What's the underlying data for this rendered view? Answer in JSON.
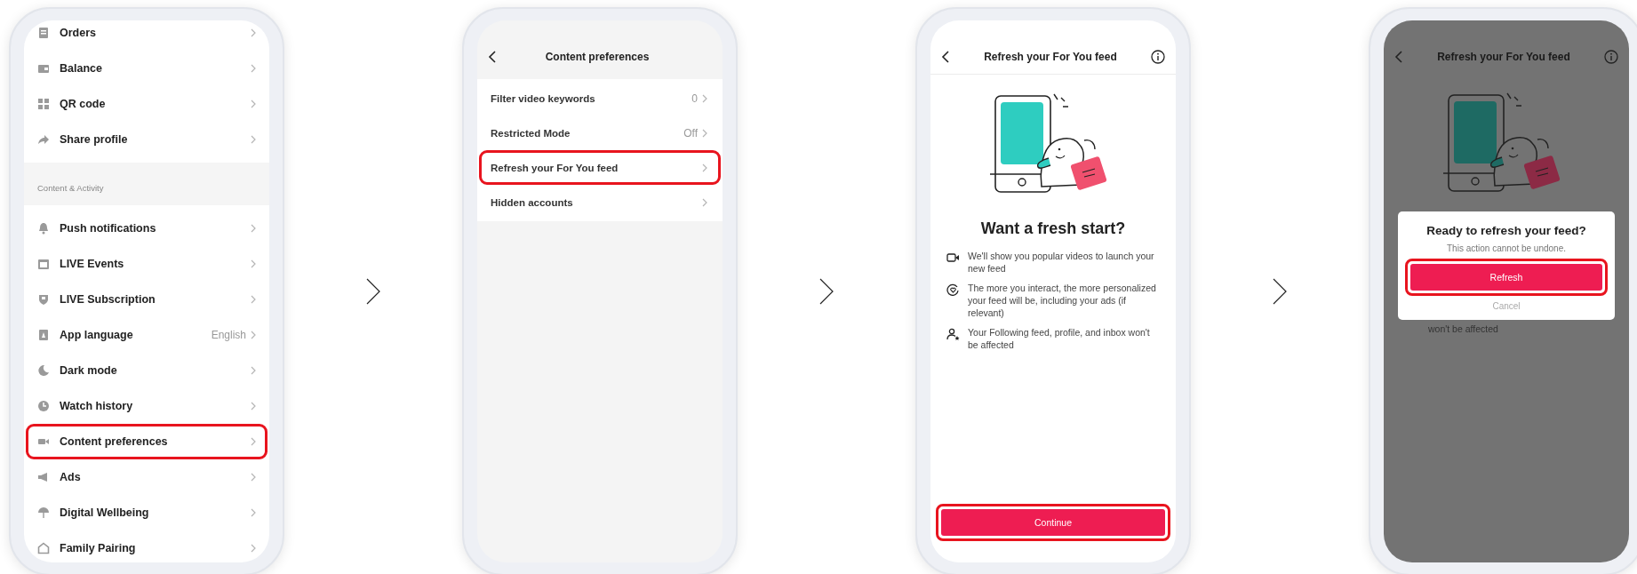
{
  "screens": [
    {
      "kind": "settings_list",
      "items": [
        {
          "kind": "row",
          "label": "Orders",
          "highlighted": false
        },
        {
          "kind": "row",
          "label": "Balance",
          "highlighted": false
        },
        {
          "kind": "row",
          "label": "QR code",
          "highlighted": false
        },
        {
          "kind": "row",
          "label": "Share profile",
          "highlighted": false
        },
        {
          "kind": "section",
          "label": "Content & Activity"
        },
        {
          "kind": "row",
          "label": "Push notifications",
          "highlighted": false
        },
        {
          "kind": "row",
          "label": "LIVE Events",
          "highlighted": false
        },
        {
          "kind": "row",
          "label": "LIVE Subscription",
          "highlighted": false
        },
        {
          "kind": "row",
          "label": "App language",
          "value": "English",
          "highlighted": false
        },
        {
          "kind": "row",
          "label": "Dark mode",
          "highlighted": false
        },
        {
          "kind": "row",
          "label": "Watch history",
          "highlighted": false
        },
        {
          "kind": "row",
          "label": "Content preferences",
          "highlighted": true
        },
        {
          "kind": "row",
          "label": "Ads",
          "highlighted": false
        },
        {
          "kind": "row",
          "label": "Digital Wellbeing",
          "highlighted": false
        },
        {
          "kind": "row",
          "label": "Family Pairing",
          "highlighted": false
        }
      ]
    },
    {
      "kind": "submenu",
      "title": "Content preferences",
      "items": [
        {
          "label": "Filter video keywords",
          "value": "0",
          "highlighted": false
        },
        {
          "label": "Restricted Mode",
          "value": "Off",
          "highlighted": false
        },
        {
          "label": "Refresh your For You feed",
          "highlighted": true
        },
        {
          "label": "Hidden accounts",
          "highlighted": false
        }
      ]
    },
    {
      "kind": "intro",
      "title": "Refresh your For You feed",
      "heading": "Want a fresh start?",
      "bullets": [
        "We'll show you popular videos to launch your new feed",
        "The more you interact, the more personalized your feed will be, including your ads (if relevant)",
        "Your Following feed, profile, and inbox won't be affected"
      ],
      "button": {
        "label": "Continue",
        "highlighted": true
      }
    },
    {
      "kind": "dialog",
      "title": "Refresh your For You feed",
      "behind_text": "won't be affected",
      "dialog": {
        "title": "Ready to refresh your feed?",
        "message": "This action cannot be undone.",
        "primary": {
          "label": "Refresh",
          "highlighted": true
        },
        "secondary": "Cancel"
      }
    }
  ]
}
